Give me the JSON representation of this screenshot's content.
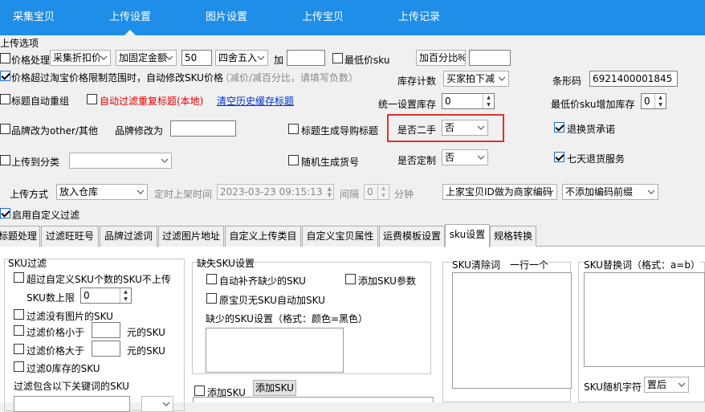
{
  "nav": {
    "tabs": [
      "采集宝贝",
      "上传设置",
      "图片设置",
      "上传宝贝",
      "上传记录"
    ],
    "active": "上传设置"
  },
  "upload_options": {
    "legend": "上传选项",
    "price_process_label": "价格处理",
    "price_source_select": "采集折扣价",
    "price_add_mode_select": "加固定金额",
    "price_amount": "50",
    "rounding_select": "四舍五入",
    "plus_label": "加",
    "plus_value": "",
    "min_price_label": "最低价sku",
    "min_price_mode_select": "加百分比%",
    "min_price_value": "",
    "price_exceed_label": "价格超过淘宝价格限制范围时，自动修改SKU价格",
    "price_exceed_hint": "（减价/减百分比，请填写负数）",
    "stock_count_label": "库存计数",
    "stock_count_select": "买家拍下减",
    "barcode_label": "条形码",
    "barcode_value": "6921400001845",
    "title_regroup_label": "标题自动重组",
    "auto_filter_title_label": "自动过滤重复标题(本地)",
    "clear_history_link": "清空历史缓存标题",
    "unified_stock_label": "统一设置库存",
    "unified_stock_value": "0",
    "min_price_sku_stock_label": "最低价sku增加库存",
    "min_price_sku_stock_value": "0",
    "brand_other_label": "品牌改为other/其他",
    "brand_modify_label": "品牌修改为",
    "brand_modify_value": "",
    "title_guide_label": "标题生成导购标题",
    "second_hand_label": "是否二手",
    "second_hand_select": "否",
    "exchange_promise_label": "退换货承诺",
    "upload_category_label": "上传到分类",
    "upload_category_select": "",
    "random_code_label": "随机生成货号",
    "custom_made_label": "是否定制",
    "custom_made_select": "否",
    "seven_day_label": "七天退货服务",
    "upload_method_label": "上传方式",
    "upload_method_select": "放入仓库",
    "scheduled_label": "定时上架时间",
    "scheduled_value": "2023-03-23 09:15:13",
    "interval_label": "间隔",
    "interval_value": "0",
    "minute_label": "分钟",
    "merchant_code_select": "上家宝贝ID做为商家编码",
    "code_prefix_select": "不添加编码前缀",
    "enable_filter_label": "启用自定义过滤"
  },
  "sub_tabs": [
    "标题处理",
    "过滤旺旺号",
    "品牌过滤词",
    "过滤图片地址",
    "自定义上传类目",
    "自定义宝贝属性",
    "运费模板设置",
    "sku设置",
    "规格转换"
  ],
  "active_sub_tab": "sku设置",
  "sku": {
    "filter_group_title": "SKU过滤",
    "exceed_custom_label": "超过自定义SKU个数的SKU不上传",
    "sku_limit_label": "SKU数上限",
    "sku_limit_value": "0",
    "no_image_label": "过滤没有图片的SKU",
    "price_less_label": "过滤价格小于",
    "price_less_value": "",
    "price_less_unit": "元的SKU",
    "price_greater_label": "过滤价格大于",
    "price_greater_value": "",
    "price_greater_unit": "元的SKU",
    "zero_stock_label": "过滤0库存的SKU",
    "keyword_label": "过滤包含以下关键词的SKU",
    "missing_group_title": "缺失SKU设置",
    "auto_fill_label": "自动补齐缺少的SKU",
    "add_param_label": "添加SKU参数",
    "no_sku_auto_label": "原宝贝无SKU自动加SKU",
    "missing_setting_label": "缺少的SKU设置（格式：颜色=黑色）",
    "clear_words_title": "SKU清除词　一行一个",
    "replace_words_title": "SKU替换词（格式：a=b）",
    "add_sku_check_label": "添加SKU",
    "add_sku_button": "添加SKU",
    "random_char_label": "SKU随机字符",
    "random_char_select": "置后"
  }
}
